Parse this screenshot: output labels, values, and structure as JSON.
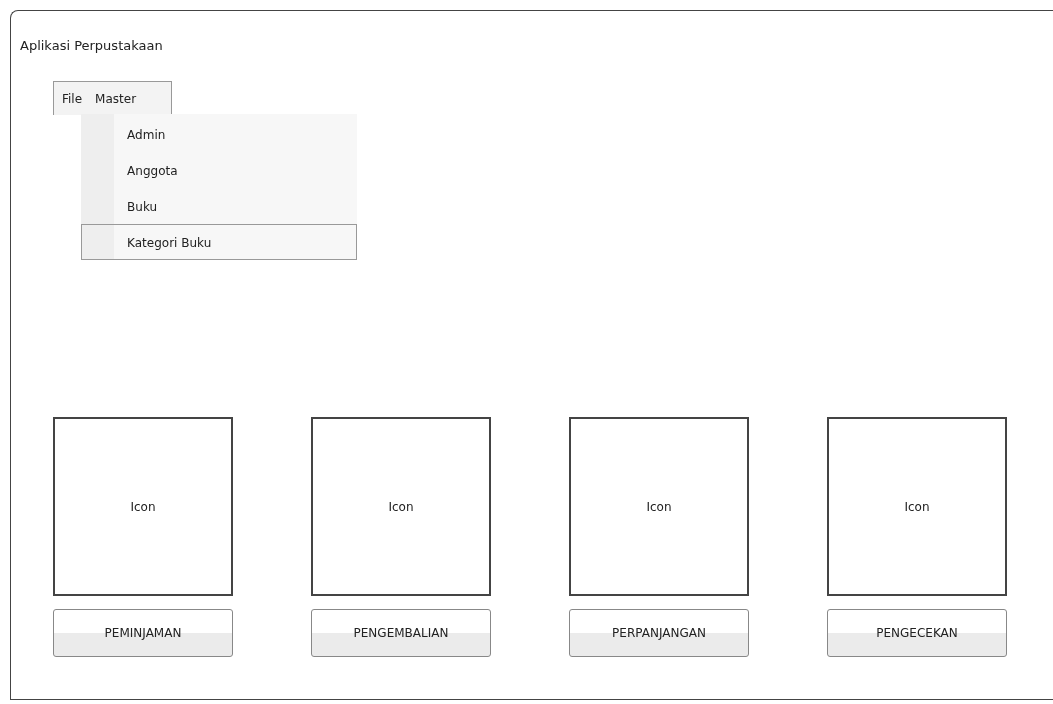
{
  "window": {
    "title": "Aplikasi Perpustakaan"
  },
  "menu_bar": [
    {
      "label": "File"
    },
    {
      "label": "Master",
      "items": [
        {
          "label": "Admin",
          "selected": false
        },
        {
          "label": "Anggota",
          "selected": false
        },
        {
          "label": "Buku",
          "selected": false
        },
        {
          "label": "Kategori Buku",
          "selected": true
        }
      ]
    }
  ],
  "tiles": [
    {
      "icon_text": "Icon",
      "button": "PEMINJAMAN"
    },
    {
      "icon_text": "Icon",
      "button": "PENGEMBALIAN"
    },
    {
      "icon_text": "Icon",
      "button": "PERPANJANGAN"
    },
    {
      "icon_text": "Icon",
      "button": "PENGECEKAN"
    }
  ]
}
